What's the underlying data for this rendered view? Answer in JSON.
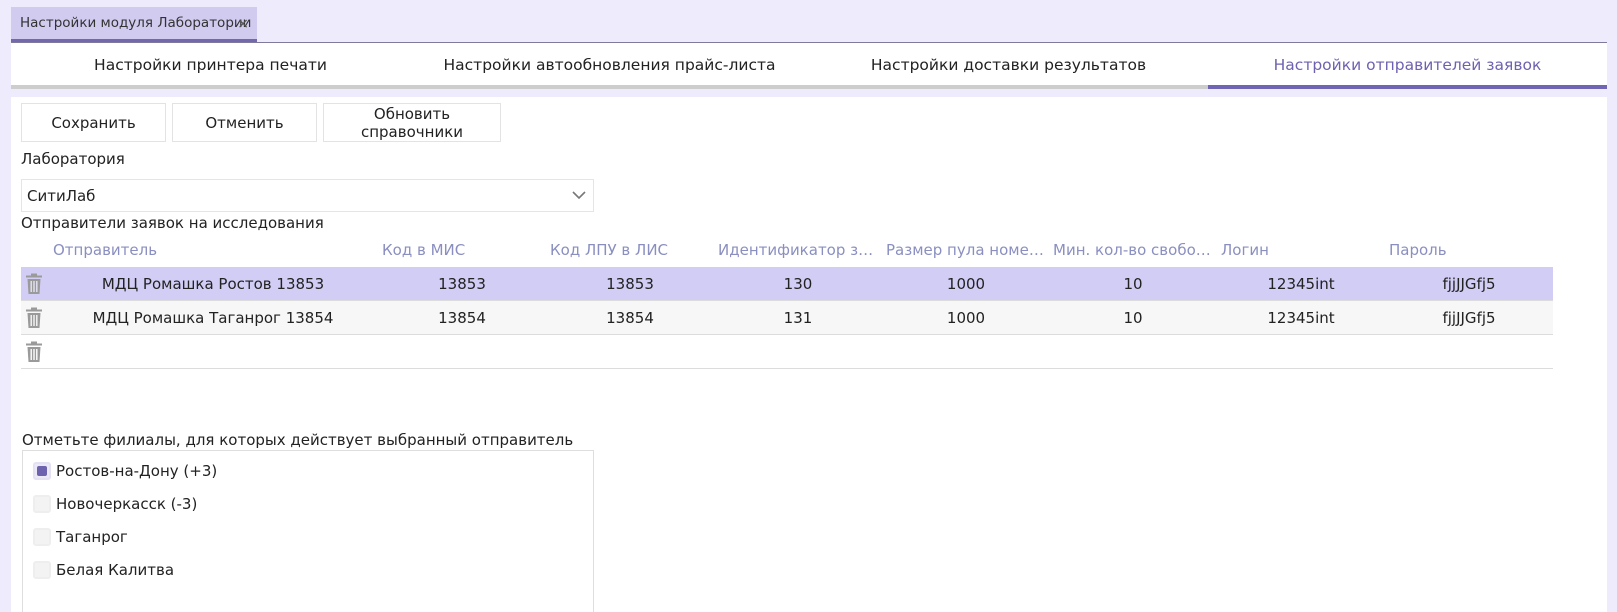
{
  "document_tab": {
    "title": "Настройки модуля Лаборатории",
    "close": "×"
  },
  "tabs": [
    {
      "label": "Настройки принтера печати",
      "active": false
    },
    {
      "label": "Настройки автообновления прайс-листа",
      "active": false
    },
    {
      "label": "Настройки доставки результатов",
      "active": false
    },
    {
      "label": "Настройки отправителей заявок",
      "active": true
    }
  ],
  "toolbar": {
    "save_label": "Сохранить",
    "cancel_label": "Отменить",
    "refresh_label": "Обновить справочники"
  },
  "laboratory": {
    "label": "Лаборатория",
    "value": "СитиЛаб"
  },
  "senders": {
    "title": "Отправители заявок на исследования",
    "columns": [
      "Отправитель",
      "Код в МИС",
      "Код ЛПУ в ЛИС",
      "Идентификатор зака...",
      "Размер пула номеро...",
      "Мин. кол-во свобод...",
      "Логин",
      "Пароль"
    ],
    "rows": [
      {
        "sender": "МДЦ Ромашка Ростов 13853",
        "mis_code": "13853",
        "lpu_code": "13853",
        "id": "130",
        "pool": "1000",
        "min_free": "10",
        "login": "12345int",
        "password": "fjjJJGfj5",
        "selected": true
      },
      {
        "sender": "МДЦ Ромашка Таганрог 13854",
        "mis_code": "13854",
        "lpu_code": "13854",
        "id": "131",
        "pool": "1000",
        "min_free": "10",
        "login": "12345int",
        "password": "fjjJJGfj5",
        "selected": false
      }
    ]
  },
  "branches": {
    "title": "Отметьте филиалы, для которых действует выбранный отправитель",
    "items": [
      {
        "label": "Ростов-на-Дону (+3)",
        "checked": true
      },
      {
        "label": "Новочеркасск (-3)",
        "checked": false
      },
      {
        "label": "Таганрог",
        "checked": false
      },
      {
        "label": "Белая Калитва",
        "checked": false
      }
    ]
  },
  "colors": {
    "accent": "#7065b4",
    "selected_row": "#d2cdf5",
    "header_text": "#8a8fc0",
    "background": "#eeecfc"
  }
}
